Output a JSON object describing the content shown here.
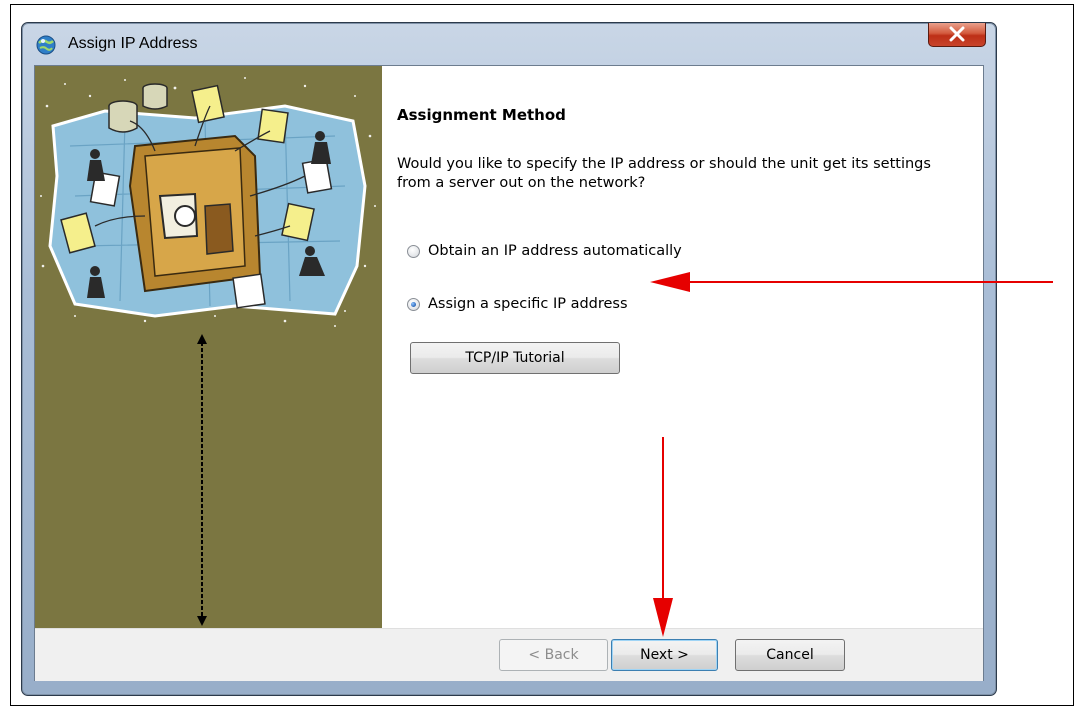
{
  "window": {
    "title": "Assign IP Address"
  },
  "content": {
    "heading": "Assignment Method",
    "question": "Would you like to specify the IP address or should the unit get its settings from a server out on the network?",
    "options": [
      {
        "label": "Obtain an IP address automatically",
        "selected": false
      },
      {
        "label": "Assign a specific IP address",
        "selected": true
      }
    ],
    "tutorial_button": "TCP/IP Tutorial"
  },
  "footer": {
    "back_label": "< Back",
    "next_label": "Next >",
    "cancel_label": "Cancel"
  },
  "colors": {
    "side_panel": "#7b7641",
    "annotation_arrow": "#e60000",
    "close_button": "#c8442a"
  },
  "icons": [
    "network-globe-icon",
    "close-icon",
    "network-illustration",
    "dimension-arrow-icon",
    "annotation-arrow-icon"
  ]
}
